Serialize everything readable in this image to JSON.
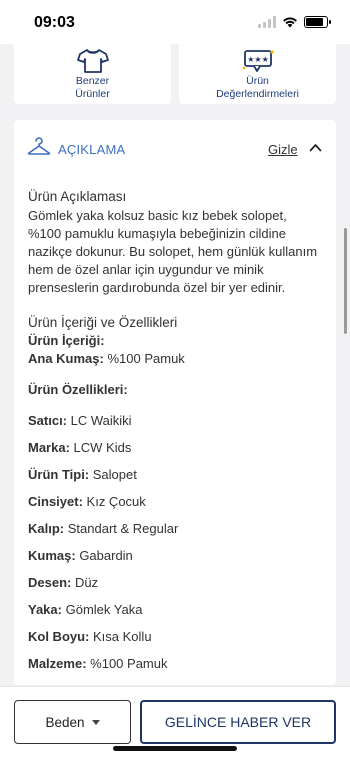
{
  "status_bar": {
    "time": "09:03"
  },
  "top_cards": [
    {
      "label_line1": "Benzer",
      "label_line2": "Ürünler",
      "icon": "tshirt-icon"
    },
    {
      "label_line1": "Ürün",
      "label_line2": "Değerlendirmeleri",
      "icon": "review-icon"
    }
  ],
  "description": {
    "title": "AÇIKLAMA",
    "hide_label": "Gizle",
    "heading": "Ürün Açıklaması",
    "paragraph": "Gömlek yaka kolsuz basic kız bebek solopet, %100 pamuklu kumaşıyla bebeğinizin cildine nazikçe dokunur. Bu solopet, hem günlük kullanım hem de özel anlar için uygundur ve minik prenseslerin gardırobunda özel bir yer edinir.",
    "contents_heading": "Ürün İçeriği ve Özellikleri",
    "content_label": "Ürün İçeriği:",
    "fabric": {
      "key": "Ana Kumaş:",
      "value": "%100 Pamuk"
    },
    "features_label": "Ürün Özellikleri:",
    "properties": [
      {
        "key": "Satıcı:",
        "value": "LC Waikiki"
      },
      {
        "key": "Marka:",
        "value": "LCW Kids"
      },
      {
        "key": "Ürün Tipi:",
        "value": "Salopet"
      },
      {
        "key": "Cinsiyet:",
        "value": "Kız Çocuk"
      },
      {
        "key": "Kalıp:",
        "value": "Standart & Regular"
      },
      {
        "key": "Kumaş:",
        "value": "Gabardin"
      },
      {
        "key": "Desen:",
        "value": "Düz"
      },
      {
        "key": "Yaka:",
        "value": "Gömlek Yaka"
      },
      {
        "key": "Kol Boyu:",
        "value": "Kısa Kollu"
      },
      {
        "key": "Malzeme:",
        "value": "%100 Pamuk"
      }
    ]
  },
  "bottom_bar": {
    "size_label": "Beden",
    "notify_label": "GELİNCE HABER VER"
  },
  "colors": {
    "accent": "#3c6fc2",
    "navy": "#1e3566",
    "background": "#f2f2f4"
  }
}
